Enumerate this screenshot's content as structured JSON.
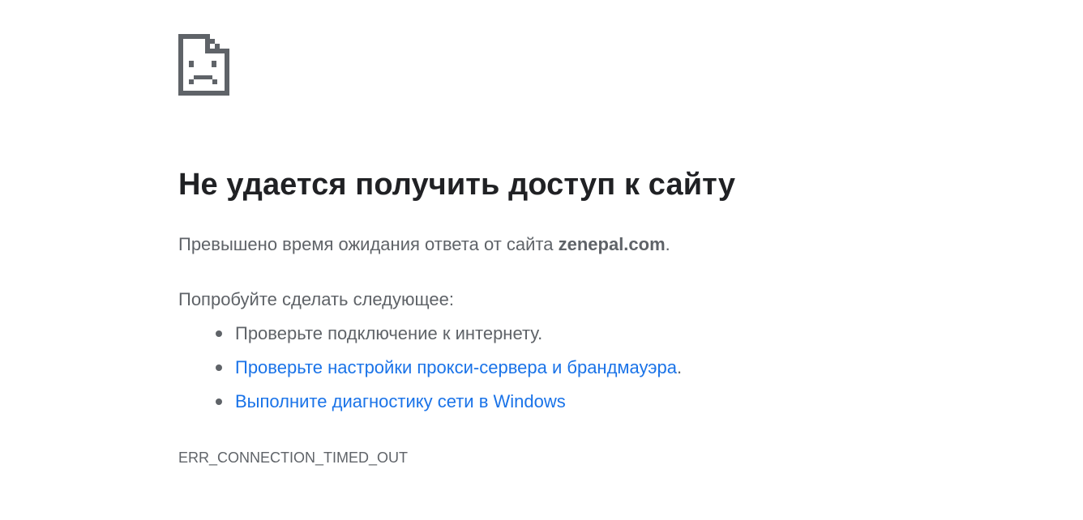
{
  "icon": "sad-page-icon",
  "colors": {
    "title": "#202124",
    "text": "#5f6368",
    "link": "#1a73e8",
    "background": "#ffffff"
  },
  "error": {
    "title": "Не удается получить доступ к сайту",
    "summary_prefix": "Превышено время ожидания ответа от сайта ",
    "host": "zenepal.com",
    "summary_suffix": ".",
    "suggestions_heading": "Попробуйте сделать следующее:",
    "suggestions": [
      {
        "text": "Проверьте подключение к интернету.",
        "suffix": ""
      },
      {
        "text": "Проверьте настройки прокси-сервера и брандмауэра",
        "suffix": "."
      },
      {
        "text": "Выполните диагностику сети в Windows",
        "suffix": ""
      }
    ],
    "code": "ERR_CONNECTION_TIMED_OUT"
  }
}
